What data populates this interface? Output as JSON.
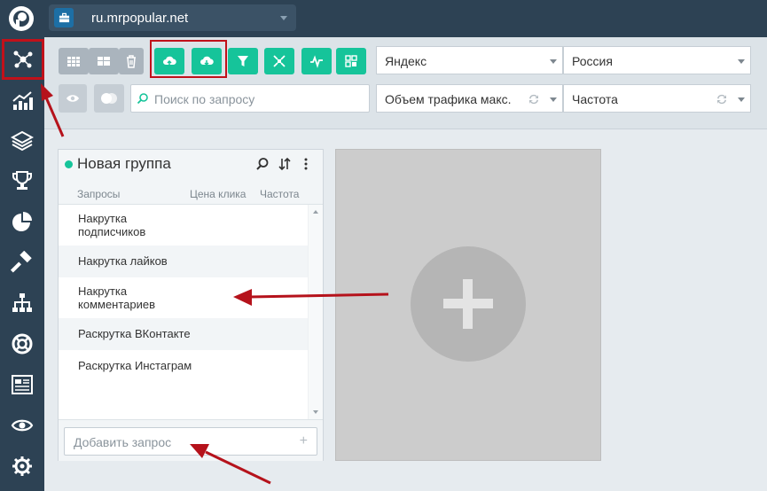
{
  "project": {
    "domain": "ru.mrpopular.net"
  },
  "sidebar": {
    "items": [
      {
        "icon": "network-icon",
        "active": true
      },
      {
        "icon": "chart-up-icon"
      },
      {
        "icon": "layers-icon"
      },
      {
        "icon": "trophy-icon"
      },
      {
        "icon": "pie-chart-icon"
      },
      {
        "icon": "hammer-icon"
      },
      {
        "icon": "sitemap-icon"
      },
      {
        "icon": "lifebuoy-icon"
      },
      {
        "icon": "report-icon"
      },
      {
        "icon": "eye-icon"
      },
      {
        "icon": "gear-icon"
      }
    ]
  },
  "toolbar": {
    "search_placeholder": "Поиск по запросу",
    "engine": "Яндекс",
    "region": "Россия",
    "traffic": "Объем трафика макс.",
    "frequency": "Частота"
  },
  "group": {
    "title": "Новая группа",
    "col_queries": "Запросы",
    "col_price": "Цена клика",
    "col_freq": "Частота",
    "rows": [
      {
        "l1": "Накрутка",
        "l2": "подписчиков"
      },
      {
        "l1": "Накрутка лайков",
        "l2": ""
      },
      {
        "l1": "Накрутка",
        "l2": "комментариев"
      },
      {
        "l1": "Раскрутка ВКонтакте",
        "l2": ""
      },
      {
        "l1": "Раскрутка Инстаграм",
        "l2": ""
      }
    ],
    "add_placeholder": "Добавить запрос",
    "add_plus": "+"
  },
  "colors": {
    "accent": "#16c49a",
    "sidebar": "#2d4254",
    "annotation": "#c1111a"
  }
}
